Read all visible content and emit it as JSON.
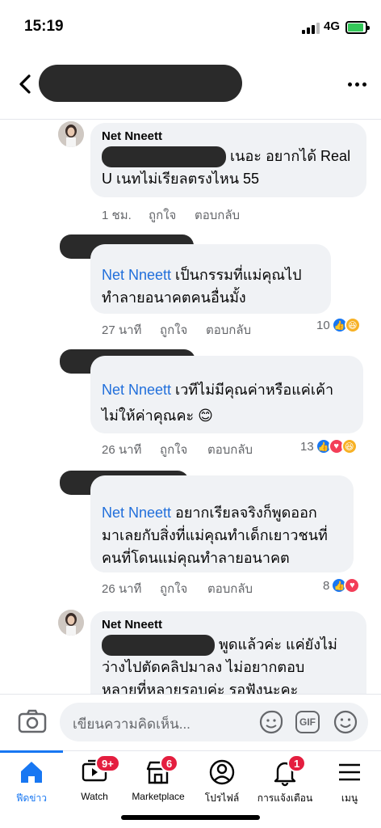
{
  "status_bar": {
    "time": "15:19",
    "network": "4G"
  },
  "comments": [
    {
      "author": "Net Nneett",
      "text_after_redaction": " เนอะ อยากได้ Real",
      "text_line2": "U เนทไม่เรียลตรงไหน 55",
      "time": "1 ชม.",
      "like_label": "ถูกใจ",
      "reply_label": "ตอบกลับ"
    },
    {
      "mention": "Net Nneett",
      "text_after_mention": " เป็นกรรมที่แม่คุณไป",
      "text_line2": "ทำลายอนาคตคนอื่นมั้ง",
      "time": "27 นาที",
      "like_label": "ถูกใจ",
      "reply_label": "ตอบกลับ",
      "reaction_count": "10"
    },
    {
      "mention": "Net Nneett",
      "text_after_mention": " เวทีไม่มีคุณค่าหรือแค่เค้า",
      "text_line2": "ไม่ให้ค่าคุณคะ 😊",
      "time": "26 นาที",
      "like_label": "ถูกใจ",
      "reply_label": "ตอบกลับ",
      "reaction_count": "13"
    },
    {
      "mention": "Net Nneett",
      "text_after_mention": " อยากเรียลจริงก็พูดออก",
      "text_line2": "มาเลยกับสิ่งที่แม่คุณทำเด็กเยาวชนที่",
      "text_line3": "คนที่โดนแม่คุณทำลายอนาคต",
      "time": "26 นาที",
      "like_label": "ถูกใจ",
      "reply_label": "ตอบกลับ",
      "reaction_count": "8"
    },
    {
      "author": "Net Nneett",
      "text_after_redaction": " พูดแล้วค่ะ  แค่ยังไม่",
      "text_line2": "ว่างไปตัดคลิปมาลง ไม่อยากตอบ",
      "text_line3": "หลายที่หลายรอบค่ะ รอฟังนะคะ"
    }
  ],
  "composer": {
    "placeholder": "เขียนความคิดเห็น...",
    "gif_label": "GIF"
  },
  "tabs": [
    {
      "label": "ฟีดข่าว"
    },
    {
      "label": "Watch",
      "badge": "9+"
    },
    {
      "label": "Marketplace",
      "badge": "6"
    },
    {
      "label": "โปรไฟล์"
    },
    {
      "label": "การแจ้งเตือน",
      "badge": "1"
    },
    {
      "label": "เมนู"
    }
  ],
  "colors": {
    "accent": "#1877f2",
    "bubble": "#f0f2f5",
    "mention": "#216fdb",
    "badge": "#e41e3f"
  }
}
